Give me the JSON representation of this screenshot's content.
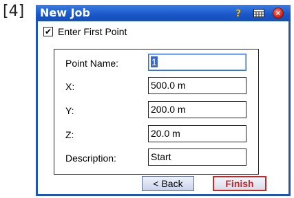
{
  "step_label": "[4]",
  "window": {
    "title": "New Job",
    "icons": [
      "help-icon",
      "keyboard-icon",
      "close-icon"
    ]
  },
  "checkbox": {
    "label": "Enter First Point",
    "checked": true
  },
  "fields": [
    {
      "label": "Point Name:",
      "value": "1"
    },
    {
      "label": "X:",
      "value": "500.0 m"
    },
    {
      "label": "Y:",
      "value": "200.0 m"
    },
    {
      "label": "Z:",
      "value": "20.0 m"
    },
    {
      "label": "Description:",
      "value": "Start"
    }
  ],
  "buttons": {
    "back": "< Back",
    "finish": "Finish"
  },
  "colors": {
    "titlebar": "#1a56c7",
    "finish_accent": "#c62828",
    "selection": "#3a67c9"
  }
}
